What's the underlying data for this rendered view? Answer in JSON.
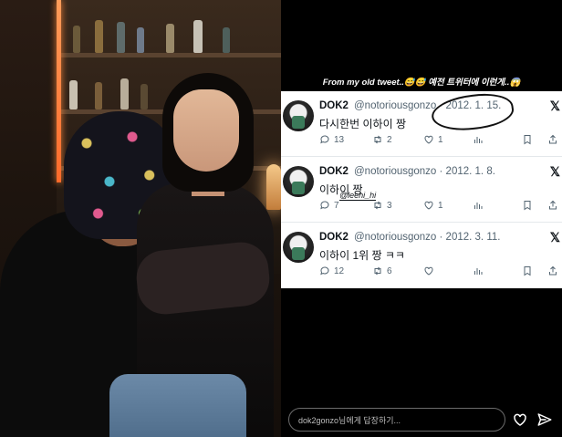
{
  "story": {
    "caption": "From my old tweet..😅😅 예전 트위터에 이런게..😱",
    "sticker": "@leehi_hi",
    "reply_placeholder": "dok2gonzo님에게 답장하기...",
    "heart_icon": "heart-icon",
    "send_icon": "send-icon"
  },
  "tweets": [
    {
      "name": "DOK2",
      "handle": "@notoriousgonzo",
      "date": "· 2012. 1. 15.",
      "text": "다시한번 이하이 짱",
      "replies": "13",
      "retweets": "2",
      "likes": "1"
    },
    {
      "name": "DOK2",
      "handle": "@notoriousgonzo",
      "date": "· 2012. 1. 8.",
      "text": "이하이 짱",
      "replies": "7",
      "retweets": "3",
      "likes": "1"
    },
    {
      "name": "DOK2",
      "handle": "@notoriousgonzo",
      "date": "· 2012. 3. 11.",
      "text": "이하이 1위 짱 ㅋㅋ",
      "replies": "12",
      "retweets": "6",
      "likes": ""
    }
  ],
  "colors": {
    "tweet_text": "#0f1419",
    "tweet_meta": "#536471",
    "photo_accent": "#ff8a3d"
  }
}
